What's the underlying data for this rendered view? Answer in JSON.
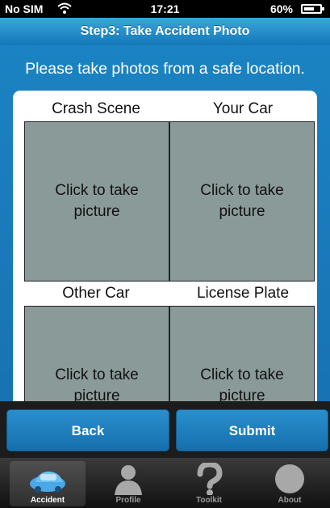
{
  "status_bar": {
    "carrier": "No SIM",
    "time": "17:21",
    "battery": "60%"
  },
  "header": {
    "title": "Step3: Take Accident Photo"
  },
  "instruction": "Please take photos from a safe location.",
  "photo_slots": [
    {
      "label": "Crash Scene",
      "prompt": "Click to take picture"
    },
    {
      "label": "Your Car",
      "prompt": "Click to take picture"
    },
    {
      "label": "Other Car",
      "prompt": "Click to take picture"
    },
    {
      "label": "License Plate",
      "prompt": "Click to take picture"
    }
  ],
  "actions": {
    "back": "Back",
    "submit": "Submit"
  },
  "tabs": [
    {
      "label": "Accident",
      "icon": "car-icon",
      "active": true
    },
    {
      "label": "Profile",
      "icon": "person-icon"
    },
    {
      "label": "Toolkit",
      "icon": "question-icon"
    },
    {
      "label": "About",
      "icon": "circle-icon"
    }
  ],
  "colors": {
    "header": "#1b7fc0",
    "background": "#1872b3",
    "slot": "#8a9a98",
    "button": "#1d80c0"
  }
}
